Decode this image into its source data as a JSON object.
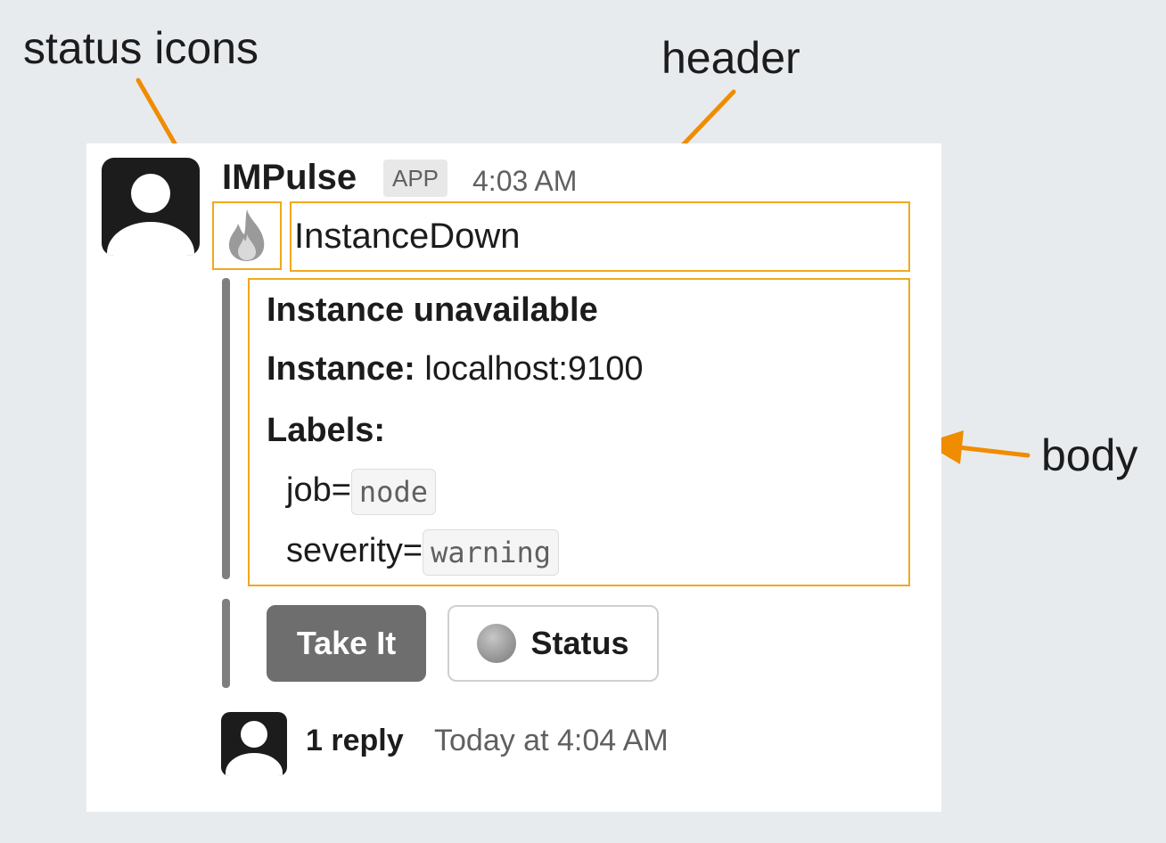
{
  "annotations": {
    "status_icons": "status icons",
    "header": "header",
    "body": "body"
  },
  "message": {
    "sender": "IMPulse",
    "app_badge": "APP",
    "timestamp": "4:03 AM",
    "status_icon": "fire-icon",
    "header_title": "InstanceDown",
    "body": {
      "title": "Instance unavailable",
      "instance_label": "Instance:",
      "instance_value": "localhost:9100",
      "labels_label": "Labels:",
      "label_job_key": "job=",
      "label_job_value": "node",
      "label_severity_key": "severity=",
      "label_severity_value": "warning"
    },
    "actions": {
      "take_it": "Take It",
      "status": "Status"
    },
    "thread": {
      "reply_count": "1 reply",
      "reply_time": "Today at 4:04 AM"
    }
  },
  "colors": {
    "background": "#e8ebee",
    "highlight": "#f0a81e",
    "arrow": "#f08c00",
    "primary_button": "#6e6e6e",
    "attachment_bar": "#7f7f7f"
  }
}
